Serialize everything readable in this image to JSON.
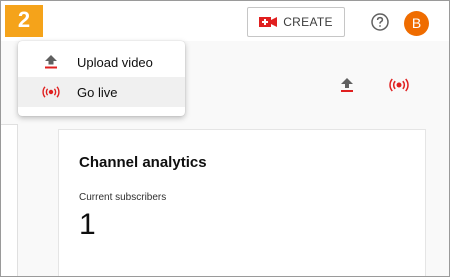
{
  "step_badge": "2",
  "topbar": {
    "create_label": "CREATE",
    "avatar_letter": "B"
  },
  "menu": {
    "items": [
      {
        "label": "Upload video",
        "icon": "upload-icon"
      },
      {
        "label": "Go live",
        "icon": "broadcast-icon"
      }
    ]
  },
  "card": {
    "title": "Channel analytics",
    "subtitle": "Current subscribers",
    "value": "1"
  },
  "colors": {
    "badge": "#f5a31a",
    "avatar": "#ef6c00",
    "brand_red": "#e02020"
  }
}
